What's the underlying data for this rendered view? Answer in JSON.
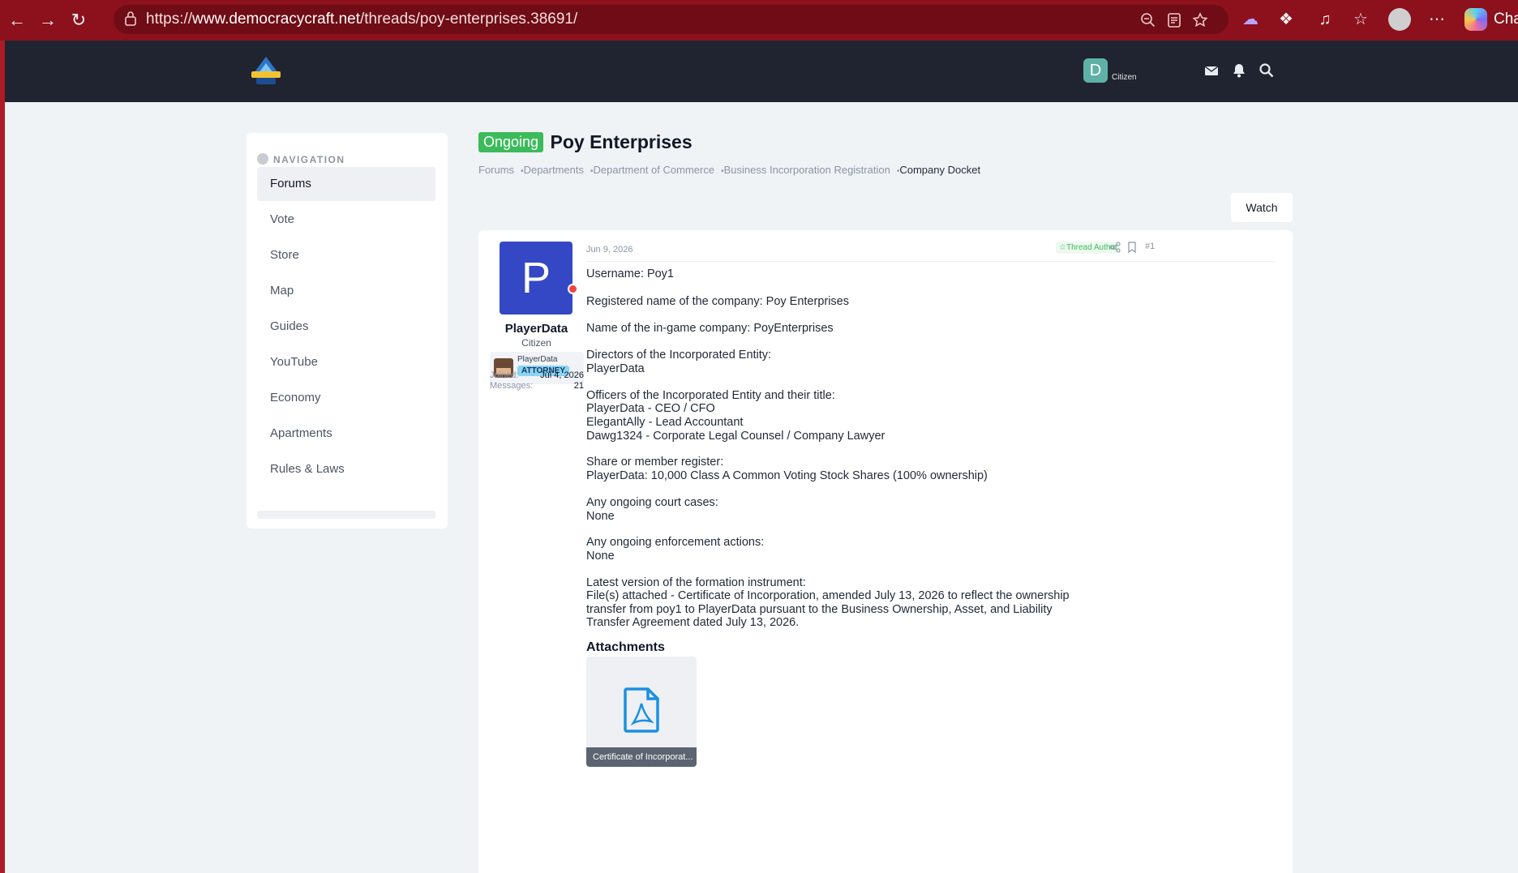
{
  "browser": {
    "url_scheme": "https://",
    "url_host": "www.democracycraft.net",
    "url_path": "/threads/poy-enterprises.38691/",
    "chat_label": "Chat"
  },
  "header": {
    "user_initial": "D",
    "user_title": "Citizen"
  },
  "sidebar": {
    "title": "NAVIGATION",
    "items": [
      {
        "label": "Forums"
      },
      {
        "label": "Vote"
      },
      {
        "label": "Store"
      },
      {
        "label": "Map"
      },
      {
        "label": "Guides"
      },
      {
        "label": "YouTube"
      },
      {
        "label": "Economy"
      },
      {
        "label": "Apartments"
      },
      {
        "label": "Rules & Laws"
      }
    ]
  },
  "thread": {
    "prefix": "Ongoing",
    "title": "Poy Enterprises",
    "breadcrumbs": [
      "Forums",
      "Departments",
      "Department of Commerce",
      "Business Incorporation Registration",
      "Company Docket"
    ],
    "watch_label": "Watch"
  },
  "post": {
    "avatar_letter": "P",
    "username": "PlayerData",
    "user_title": "Citizen",
    "banner_name": "PlayerData",
    "banner_role": "ATTORNEY",
    "joined_label": "Joined:",
    "joined_value": "Jul 4, 2026",
    "messages_label": "Messages:",
    "messages_value": "21",
    "date": "Jun 9, 2026",
    "author_badge": "Thread Author",
    "number": "#1",
    "lines": [
      "Username: Poy1",
      "Registered name of the company: Poy Enterprises",
      "Name of the in-game company: PoyEnterprises",
      "Directors of the Incorporated Entity:",
      "PlayerData",
      "Officers of the Incorporated Entity and their title:",
      "PlayerData - CEO / CFO",
      "ElegantAlly - Lead Accountant",
      "Dawg1324 - Corporate Legal Counsel / Company Lawyer",
      "Share or member register:",
      "PlayerData: 10,000 Class A Common Voting Stock Shares (100% ownership)",
      "Any ongoing court cases:",
      "None",
      "Any ongoing enforcement actions:",
      "None",
      "Latest version of the formation instrument:",
      "File(s) attached - Certificate of Incorporation, amended July 13, 2026 to reflect the ownership",
      "transfer from poy1 to PlayerData pursuant to the Business Ownership, Asset, and Liability",
      "Transfer Agreement dated July 13, 2026."
    ],
    "attachments_title": "Attachments",
    "attachment_name": "Certificate of Incorporat..."
  }
}
